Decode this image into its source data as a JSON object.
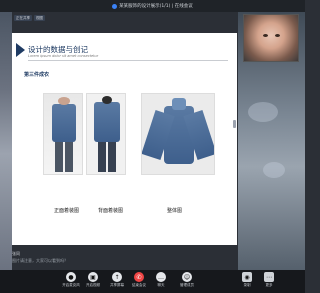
{
  "window": {
    "title": "某某服饰的设计展示(1/1) | 在线会议"
  },
  "top_chips": [
    "正在共享",
    "视图"
  ],
  "slide": {
    "title": "设计的数据与创记",
    "subtitle": "Lorem ipsum dolor sit amet consectetur",
    "section": "第三件成衣",
    "captions": [
      "正面着装图",
      "背面着装图",
      "整体图"
    ]
  },
  "chat": {
    "sender": "张同",
    "message": "图片请注意，大家可以看到吗？"
  },
  "toolbar": {
    "items": [
      {
        "label": "开启麦克风",
        "icon": "mic-icon"
      },
      {
        "label": "开启视频",
        "icon": "camera-icon"
      },
      {
        "label": "共享屏幕",
        "icon": "share-icon"
      },
      {
        "label": "结束会议",
        "icon": "end-call-icon"
      },
      {
        "label": "聊天",
        "icon": "chat-icon"
      },
      {
        "label": "管理成员",
        "icon": "members-icon"
      },
      {
        "label": "录制",
        "icon": "record-icon"
      },
      {
        "label": "更多",
        "icon": "more-icon"
      }
    ]
  },
  "colors": {
    "accent": "#1f3b63",
    "end_call": "#ef4444"
  }
}
